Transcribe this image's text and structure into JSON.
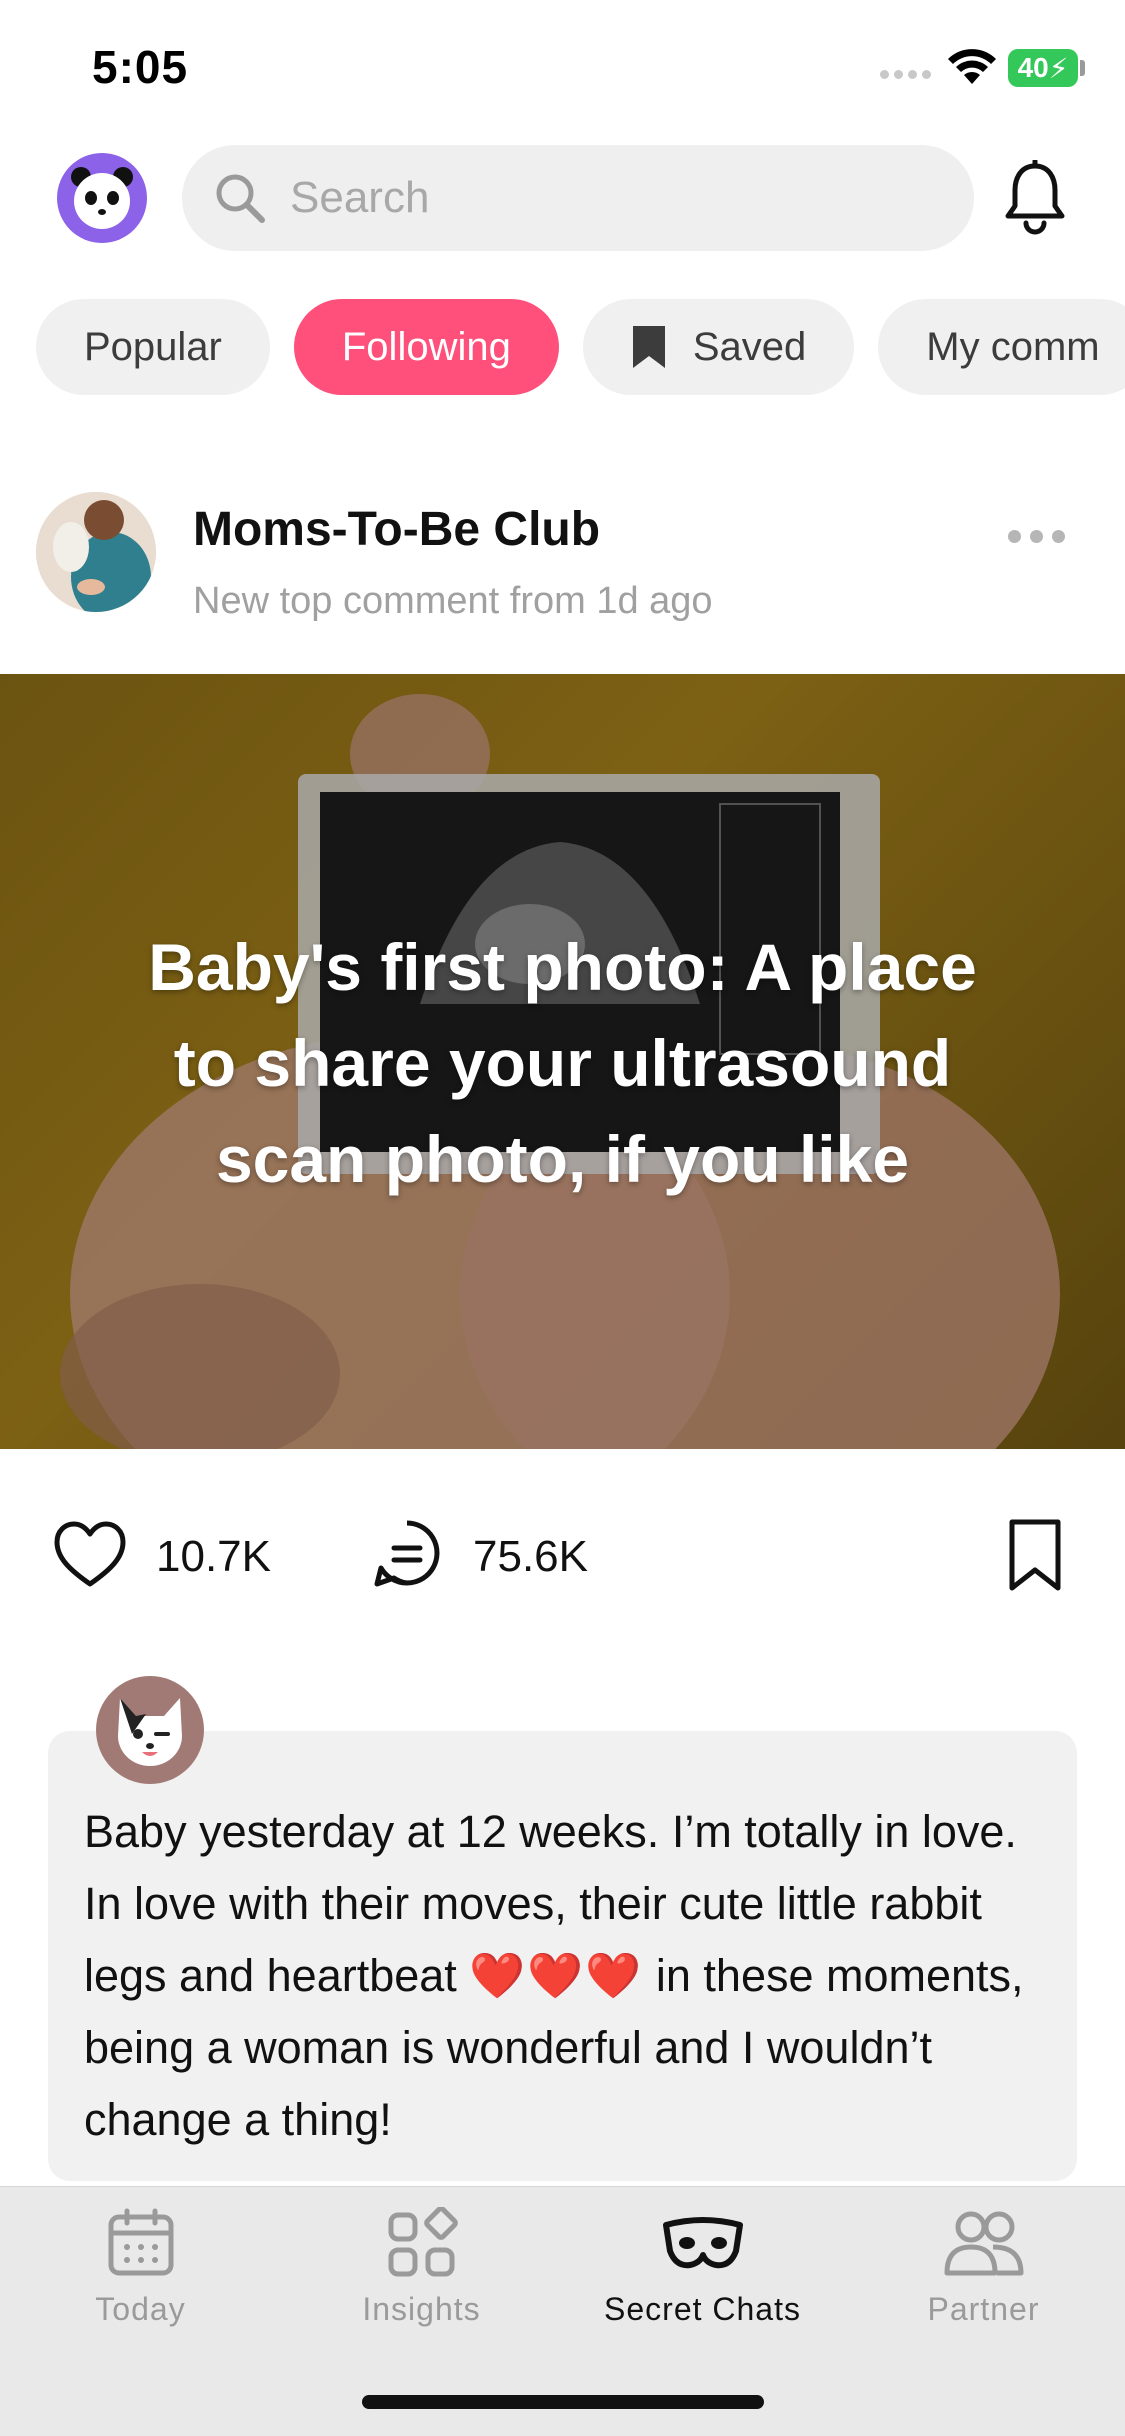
{
  "status_bar": {
    "time": "5:05",
    "battery": "40"
  },
  "search": {
    "placeholder": "Search"
  },
  "chips": [
    {
      "label": "Popular",
      "active": false
    },
    {
      "label": "Following",
      "active": true
    },
    {
      "label": "Saved",
      "active": false,
      "icon": "bookmark-icon"
    },
    {
      "label": "My comm",
      "active": false
    }
  ],
  "post": {
    "group_name": "Moms-To-Be Club",
    "subtitle": "New top comment from 1d ago",
    "hero_title": "Baby's first photo: A place to share your ultrasound scan photo, if you like",
    "likes": "10.7K",
    "comments": "75.6K"
  },
  "comment": {
    "text_before_hearts": "Baby yesterday at 12 weeks. I’m totally in love. In love with their moves, their cute little rabbit legs and heartbeat ",
    "hearts": "❤️❤️❤️",
    "text_after_hearts": " in these moments, being a woman is wonderful and I wouldn’t change a thing!"
  },
  "tabs": [
    {
      "label": "Today",
      "icon": "calendar-icon"
    },
    {
      "label": "Insights",
      "icon": "insights-grid-icon"
    },
    {
      "label": "Secret Chats",
      "icon": "mask-icon",
      "active": true
    },
    {
      "label": "Partner",
      "icon": "partner-icon"
    }
  ],
  "colors": {
    "accent": "#ff4f7b",
    "avatar_purple": "#8c62e8",
    "battery_green": "#34c759"
  }
}
